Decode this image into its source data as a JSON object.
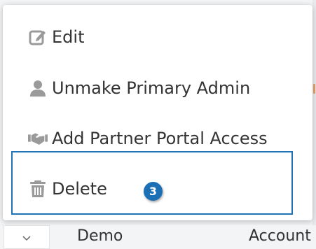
{
  "menu": {
    "items": [
      {
        "label": "Edit",
        "icon": "edit-icon"
      },
      {
        "label": "Unmake Primary Admin",
        "icon": "user-icon"
      },
      {
        "label": "Add Partner Portal Access",
        "icon": "handshake-icon"
      },
      {
        "label": "Delete",
        "icon": "trash-icon"
      }
    ]
  },
  "annotation": {
    "step_number": "3",
    "highlight_color": "#1f73b7"
  },
  "table_header": {
    "select_icon": "chevron-down-icon",
    "columns": [
      "Demo",
      "Account"
    ]
  },
  "colors": {
    "icon_gray": "#9a9a9a",
    "text": "#333333",
    "badge": "#1a6fb5"
  }
}
